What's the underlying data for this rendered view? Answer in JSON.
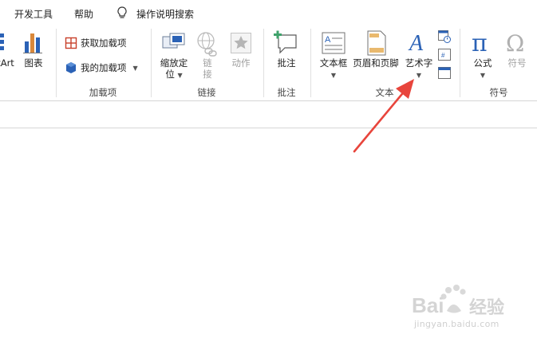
{
  "menu": {
    "items": [
      "开发工具",
      "帮助"
    ],
    "tell_me": "操作说明搜索"
  },
  "ribbon": {
    "illustrations": {
      "smartart_label": "tArt",
      "chart_label": "图表"
    },
    "addins": {
      "get_addins": "获取加载项",
      "my_addins": "我的加载项",
      "group": "加载项"
    },
    "links": {
      "zoom_label_1": "缩放定",
      "zoom_label_2": "位",
      "link_1": "链",
      "link_2": "接",
      "action": "动作",
      "group": "链接"
    },
    "comments": {
      "comment": "批注",
      "group": "批注"
    },
    "text": {
      "textbox": "文本框",
      "header_footer": "页眉和页脚",
      "wordart": "艺术字",
      "group": "文本"
    },
    "symbols": {
      "equation": "公式",
      "symbol": "符号",
      "group": "符号"
    }
  },
  "watermark": {
    "brand": "Bai",
    "brand2": "经验",
    "url": "jingyan.baidu.com"
  },
  "colors": {
    "arrow": "#e8453c",
    "accent_blue": "#2b62b6",
    "orange_icon": "#d9883a",
    "red_icon": "#c8402a"
  }
}
